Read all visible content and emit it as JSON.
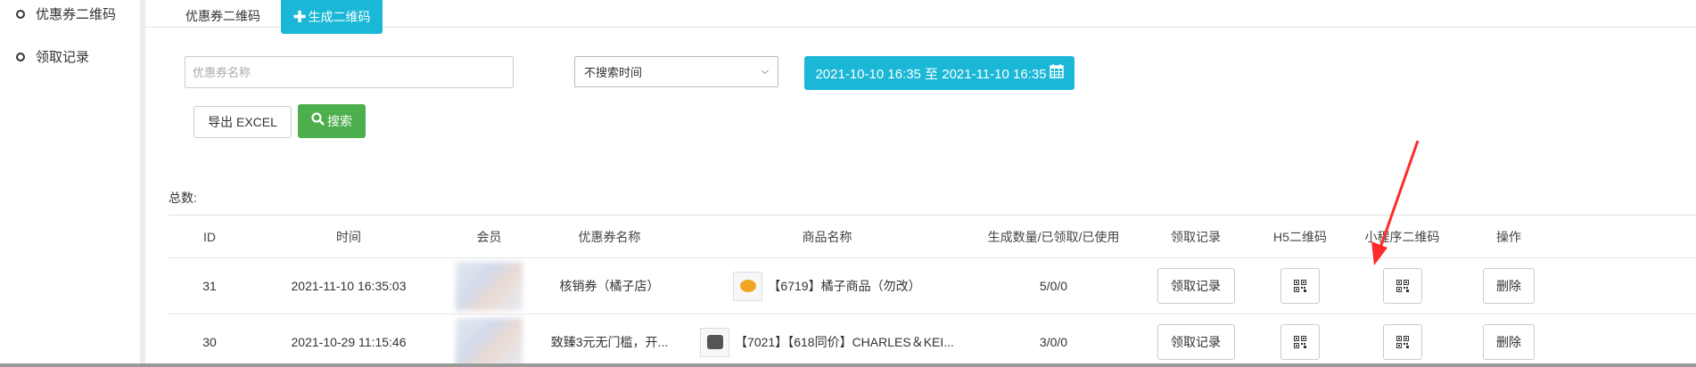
{
  "sidebar": {
    "items": [
      {
        "label": "优惠券二维码"
      },
      {
        "label": "领取记录"
      }
    ]
  },
  "tabs": {
    "current": "优惠券二维码",
    "generate_button": "生成二维码"
  },
  "filters": {
    "name_placeholder": "优惠券名称",
    "time_select": "不搜索时间",
    "date_range": "2021-10-10 16:35 至 2021-11-10 16:35",
    "export_button": "导出 EXCEL",
    "search_button": "搜索"
  },
  "summary": {
    "total_label": "总数:"
  },
  "table": {
    "headers": [
      "ID",
      "时间",
      "会员",
      "优惠券名称",
      "商品名称",
      "生成数量/已领取/已使用",
      "领取记录",
      "H5二维码",
      "小程序二维码",
      "操作"
    ],
    "rows": [
      {
        "id": "31",
        "time": "2021-11-10 16:35:03",
        "coupon": "核销券（橘子店）",
        "product": "【6719】橘子商品（勿改）",
        "product_thumb": "orange",
        "counts": "5/0/0",
        "record_button": "领取记录",
        "delete_button": "删除"
      },
      {
        "id": "30",
        "time": "2021-10-29 11:15:46",
        "coupon": "致臻3元无门槛，开...",
        "product": "【7021】【618同价】CHARLES＆KEI...",
        "product_thumb": "bag",
        "counts": "3/0/0",
        "record_button": "领取记录",
        "delete_button": "删除"
      }
    ]
  },
  "colors": {
    "accent": "#1ab7d6",
    "search_green": "#4cae4c",
    "arrow_red": "#ff2a2a"
  }
}
